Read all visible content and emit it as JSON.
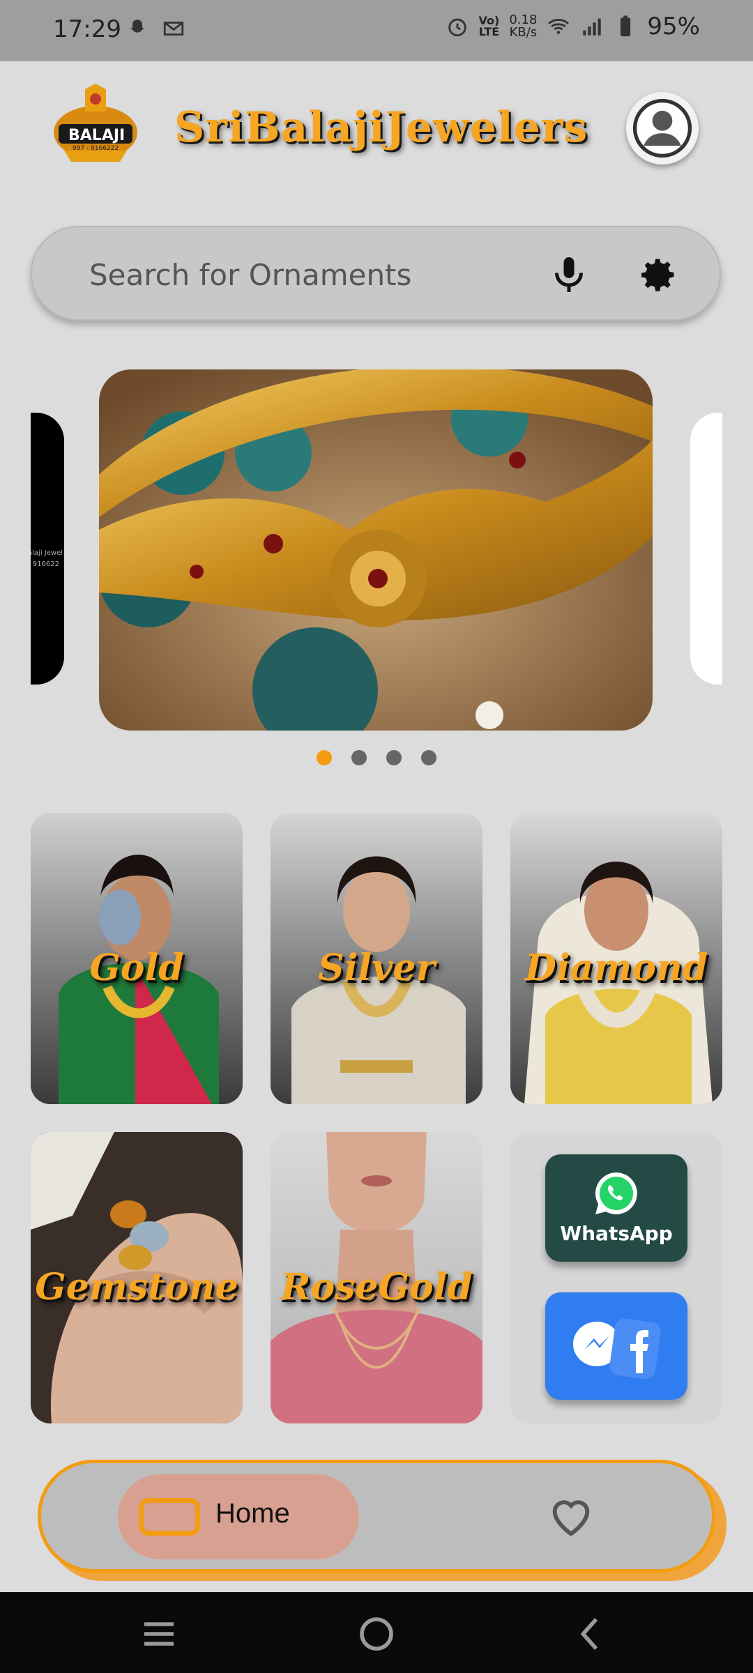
{
  "status_bar": {
    "time": "17:29",
    "network_speed": "0.18\nKB/s",
    "volte": "Vo)\nLTE",
    "battery": "95%"
  },
  "header": {
    "logo_text": "BALAJI",
    "logo_sub": "997 - 9166222",
    "brand_name": "SriBalajiJewelers"
  },
  "search": {
    "placeholder": "Search for Ornaments"
  },
  "carousel": {
    "peek_text": "alaji Jewel",
    "peek_text2": "- 916622",
    "dots": 4,
    "active_index": 0
  },
  "categories": [
    {
      "label": "Gold"
    },
    {
      "label": "Silver"
    },
    {
      "label": "Diamond"
    },
    {
      "label": "Gemstone"
    },
    {
      "label": "RoseGold"
    }
  ],
  "social": {
    "whatsapp_label": "WhatsApp"
  },
  "bottom_nav": {
    "home_label": "Home"
  },
  "colors": {
    "accent": "#f39c12",
    "brand": "#f6a623",
    "background": "#dcdcdc"
  }
}
